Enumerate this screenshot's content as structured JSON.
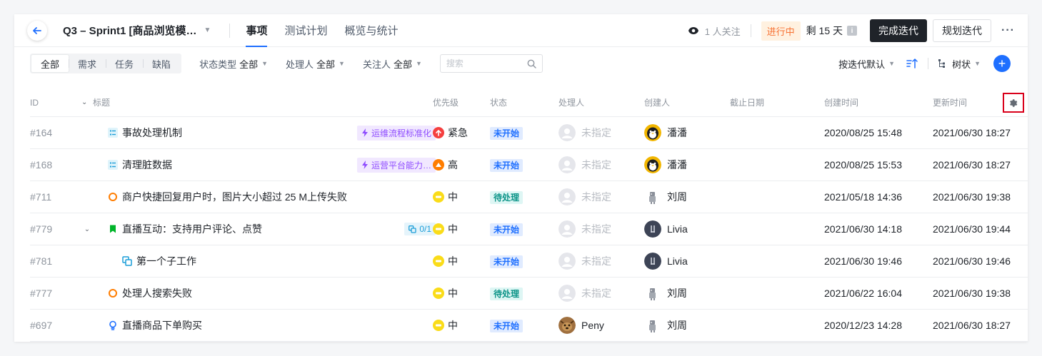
{
  "header": {
    "title": "Q3 – Sprint1 [商品浏览模…",
    "tabs": [
      {
        "label": "事项",
        "active": true
      },
      {
        "label": "测试计划",
        "active": false
      },
      {
        "label": "概览与统计",
        "active": false
      }
    ],
    "watchers": "1 人关注",
    "status_tag": "进行中",
    "remaining": "剩 15 天",
    "complete_btn": "完成迭代",
    "plan_btn": "规划迭代",
    "more": "···"
  },
  "toolbar": {
    "segments": [
      {
        "label": "全部",
        "active": true
      },
      {
        "label": "需求",
        "active": false
      },
      {
        "label": "任务",
        "active": false
      },
      {
        "label": "缺陷",
        "active": false
      }
    ],
    "filters": [
      {
        "label": "状态类型",
        "value": "全部"
      },
      {
        "label": "处理人",
        "value": "全部"
      },
      {
        "label": "关注人",
        "value": "全部"
      }
    ],
    "search_placeholder": "搜索",
    "sort_label": "按迭代默认",
    "view_label": "树状"
  },
  "table": {
    "columns": {
      "id": "ID",
      "title": "标题",
      "priority": "优先级",
      "status": "状态",
      "assignee": "处理人",
      "creator": "创建人",
      "due": "截止日期",
      "created": "创建时间",
      "updated": "更新时间"
    },
    "rows": [
      {
        "id": "#164",
        "type": "story",
        "title": "事故处理机制",
        "chip": "运维流程标准化",
        "chip_type": "purple",
        "priority": "紧急",
        "priority_level": "urgent",
        "status": "未开始",
        "status_type": "blue",
        "assignee": "未指定",
        "assignee_avatar": "empty",
        "creator": "潘潘",
        "creator_avatar": "penguin",
        "created": "2020/08/25 15:48",
        "updated": "2021/06/30 18:27",
        "expander": "",
        "indent": 0
      },
      {
        "id": "#168",
        "type": "story",
        "title": "清理脏数据",
        "chip": "运营平台能力…",
        "chip_type": "purple",
        "priority": "高",
        "priority_level": "high",
        "status": "未开始",
        "status_type": "blue",
        "assignee": "未指定",
        "assignee_avatar": "empty",
        "creator": "潘潘",
        "creator_avatar": "penguin",
        "created": "2020/08/25 15:53",
        "updated": "2021/06/30 18:27",
        "expander": "",
        "indent": 0
      },
      {
        "id": "#711",
        "type": "bug",
        "title": "商户快捷回复用户时，图片大小超过 25 M上传失败",
        "chip": "",
        "chip_type": "",
        "priority": "中",
        "priority_level": "medium",
        "status": "待处理",
        "status_type": "teal",
        "assignee": "未指定",
        "assignee_avatar": "empty",
        "creator": "刘周",
        "creator_avatar": "robot",
        "created": "2021/05/18 14:36",
        "updated": "2021/06/30 19:38",
        "expander": "",
        "indent": 0
      },
      {
        "id": "#779",
        "type": "task",
        "title": "直播互动：支持用户评论、点赞",
        "chip": "0/1",
        "chip_type": "teal",
        "priority": "中",
        "priority_level": "medium",
        "status": "未开始",
        "status_type": "blue",
        "assignee": "未指定",
        "assignee_avatar": "empty",
        "creator": "Livia",
        "creator_avatar": "livia",
        "created": "2021/06/30 14:18",
        "updated": "2021/06/30 19:44",
        "expander": "⌄",
        "indent": 0
      },
      {
        "id": "#781",
        "type": "subtask",
        "title": "第一个子工作",
        "chip": "",
        "chip_type": "",
        "priority": "中",
        "priority_level": "medium",
        "status": "未开始",
        "status_type": "blue",
        "assignee": "未指定",
        "assignee_avatar": "empty",
        "creator": "Livia",
        "creator_avatar": "livia",
        "created": "2021/06/30 19:46",
        "updated": "2021/06/30 19:46",
        "expander": "",
        "indent": 1
      },
      {
        "id": "#777",
        "type": "bug",
        "title": "处理人搜索失败",
        "chip": "",
        "chip_type": "",
        "priority": "中",
        "priority_level": "medium",
        "status": "待处理",
        "status_type": "teal",
        "assignee": "未指定",
        "assignee_avatar": "empty",
        "creator": "刘周",
        "creator_avatar": "robot",
        "created": "2021/06/22 16:04",
        "updated": "2021/06/30 19:38",
        "expander": "",
        "indent": 0
      },
      {
        "id": "#697",
        "type": "idea",
        "title": "直播商品下单购买",
        "chip": "",
        "chip_type": "",
        "priority": "中",
        "priority_level": "medium",
        "status": "未开始",
        "status_type": "blue",
        "assignee": "Peny",
        "assignee_avatar": "dog",
        "creator": "刘周",
        "creator_avatar": "robot",
        "created": "2020/12/23 14:28",
        "updated": "2021/06/30 18:27",
        "expander": "",
        "indent": 0
      }
    ]
  },
  "colors": {
    "accent": "#1e6fff",
    "urgent": "#f53f3f",
    "high": "#ff7d00",
    "medium": "#fadc19",
    "highlight_border": "#d9001b"
  }
}
